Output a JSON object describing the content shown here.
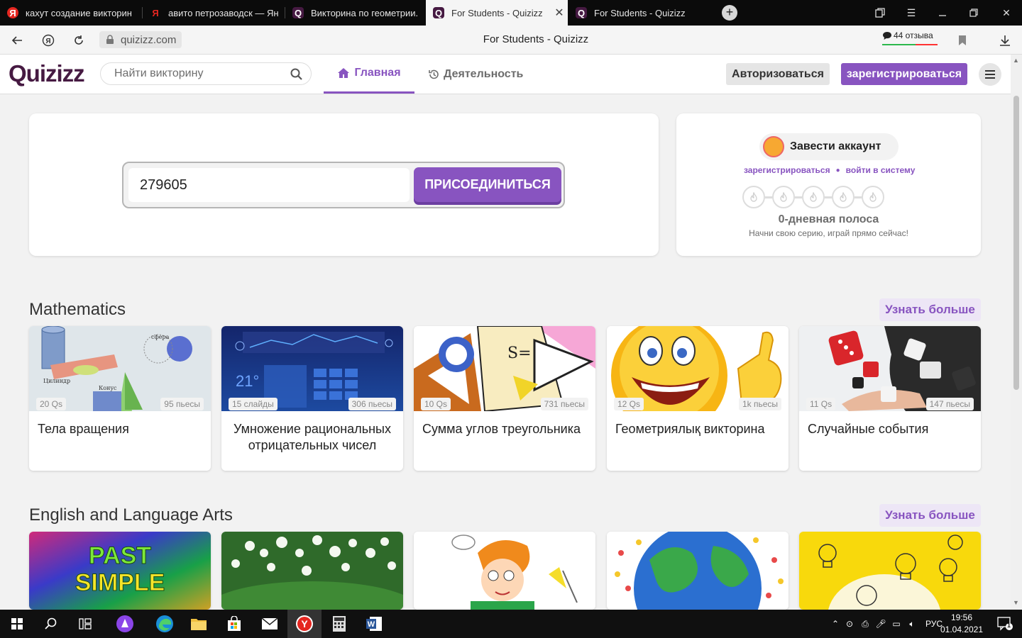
{
  "browser": {
    "tabs": [
      {
        "title": "кахут создание викторин",
        "icon": "yandex-icon"
      },
      {
        "title": "авито петрозаводск — Ян",
        "icon": "yandex-icon"
      },
      {
        "title": "Викторина по геометрии.",
        "icon": "quizizz-icon"
      },
      {
        "title": "For Students - Quizizz",
        "icon": "quizizz-icon",
        "active": true
      },
      {
        "title": "For Students - Quizizz",
        "icon": "quizizz-icon"
      }
    ],
    "url": "quizizz.com",
    "page_title": "For Students - Quizizz",
    "reviews": "44 отзыва"
  },
  "site": {
    "logo": "Quizizz",
    "search_placeholder": "Найти викторину",
    "nav": {
      "home": "Главная",
      "activity": "Деятельность"
    },
    "login": "Авторизоваться",
    "signup": "зарегистрироваться"
  },
  "join": {
    "code": "279605",
    "button": "ПРИСОЕДИНИТЬСЯ"
  },
  "account": {
    "create": "Завести аккаунт",
    "signup_link": "зарегистрироваться",
    "signin_link": "войти в систему",
    "streak_title": "0-дневная полоса",
    "streak_sub": "Начни свою серию, играй прямо сейчас!"
  },
  "sections": [
    {
      "title": "Mathematics",
      "more": "Узнать больше",
      "cards": [
        {
          "title": "Тела вращения",
          "left": "20 Qs",
          "right": "95 пьесы"
        },
        {
          "title": "Умножение рациональных отрицательных чисел",
          "left": "15 слайды",
          "right": "306 пьесы"
        },
        {
          "title": "Сумма углов треугольника",
          "left": "10 Qs",
          "right": "731 пьесы"
        },
        {
          "title": "Геометриялық викторина",
          "left": "12 Qs",
          "right": "1k пьесы"
        },
        {
          "title": "Случайные события",
          "left": "11 Qs",
          "right": "147 пьесы"
        }
      ]
    },
    {
      "title": "English and Language Arts",
      "more": "Узнать больше",
      "cards": [
        {
          "image_text": "PAST SIMPLE"
        },
        {},
        {},
        {},
        {}
      ]
    }
  ],
  "taskbar": {
    "lang": "РУС",
    "time": "19:56",
    "date": "01.04.2021",
    "notifications": "1"
  },
  "colors": {
    "brand": "#8854c0",
    "logo": "#461a42"
  }
}
